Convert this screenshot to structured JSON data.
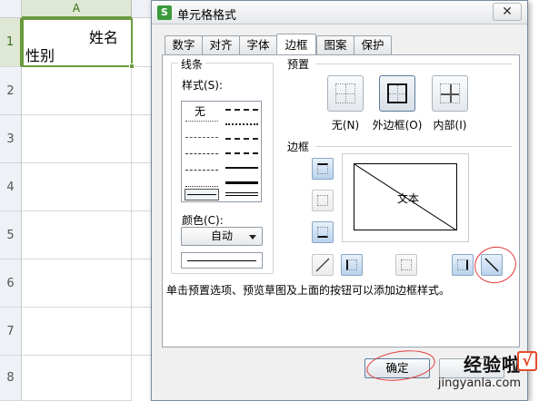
{
  "sheet": {
    "column_header": "A",
    "rows": [
      "1",
      "2",
      "3",
      "4",
      "5",
      "6",
      "7",
      "8"
    ],
    "a1_line1": "姓名",
    "a1_line2": "性别"
  },
  "dialog": {
    "title": "单元格格式",
    "close_label": "✕",
    "tabs": [
      "数字",
      "对齐",
      "字体",
      "边框",
      "图案",
      "保护"
    ],
    "active_tab": "边框",
    "line_group": {
      "label": "线条",
      "style_label": "样式(S):",
      "none_label": "无",
      "color_label": "颜色(C):",
      "color_value": "自动"
    },
    "preset": {
      "label": "预置",
      "items": [
        "无(N)",
        "外边框(O)",
        "内部(I)"
      ]
    },
    "border": {
      "label": "边框",
      "preview_text": "文本"
    },
    "hint": "单击预置选项、预览草图及上面的按钮可以添加边框样式。",
    "ok_label": "确定"
  },
  "watermark": {
    "main": "经验啦",
    "check": "√",
    "sub": "jingyanla.com"
  },
  "colors": {
    "selection_green": "#6a9a3e",
    "active_border_button": "#b9d2ec",
    "annotation_red": "#e23a3a",
    "app_icon_green": "#3a9a3c"
  }
}
